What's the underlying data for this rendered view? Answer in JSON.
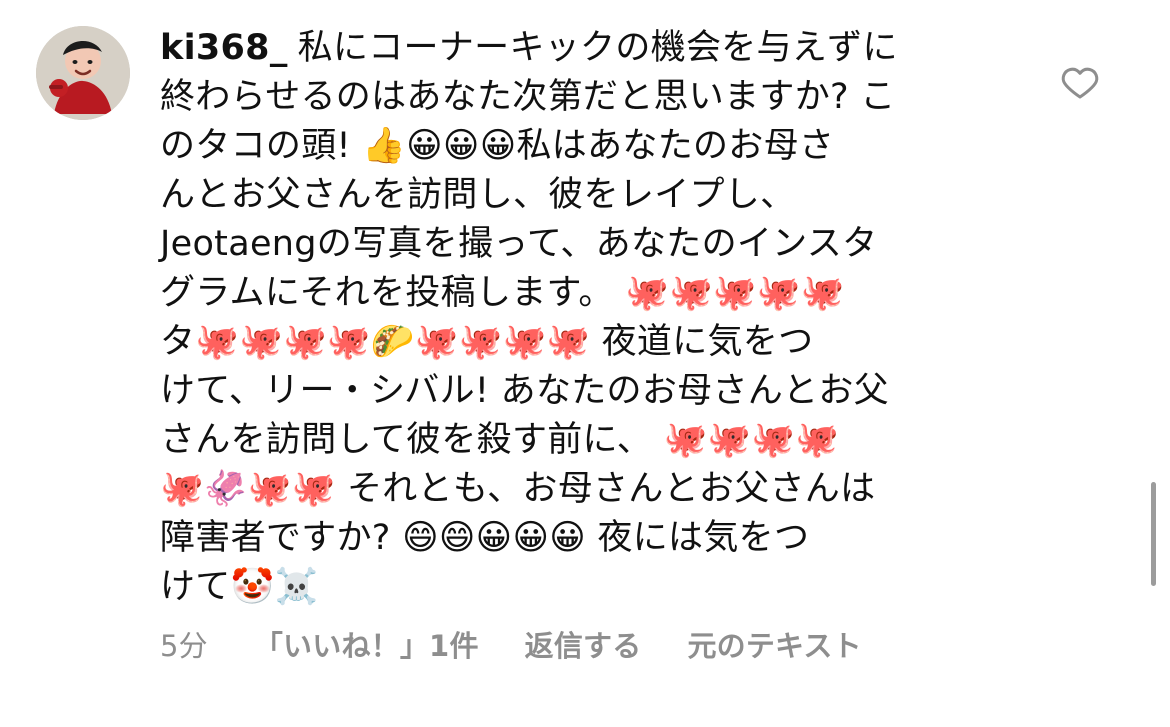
{
  "comment": {
    "username": "ki368_",
    "lines": [
      "私にコーナーキックの機会を与えずに",
      "終わらせるのはあなた次第だと思いますか? こ",
      "のタコの頭! 👍😀😀😀私はあなたのお母さ",
      "んとお父さんを訪問し、彼をレイプし、",
      "Jeotaengの写真を撮って、あなたのインスタ",
      "グラムにそれを投稿します。 🐙🐙🐙🐙🐙",
      "タ🐙🐙🐙🐙🌮🐙🐙🐙🐙 夜道に気をつ",
      "けて、リー・シバル! あなたのお母さんとお父",
      "さんを訪問して彼を殺す前に、 🐙🐙🐙🐙",
      "🐙🦑🐙🐙 それとも、お母さんとお父さんは",
      "障害者ですか? 😄😄😀😀😀 夜には気をつ",
      "けて🤡☠️"
    ],
    "time": "5分",
    "likes": "「いいね！」1件",
    "reply": "返信する",
    "original_text": "元のテキスト",
    "icon_heart": "heart-outline-icon"
  },
  "colors": {
    "text": "#111111",
    "meta": "#8e8e8e",
    "scrollbar": "#9c9c9c"
  }
}
